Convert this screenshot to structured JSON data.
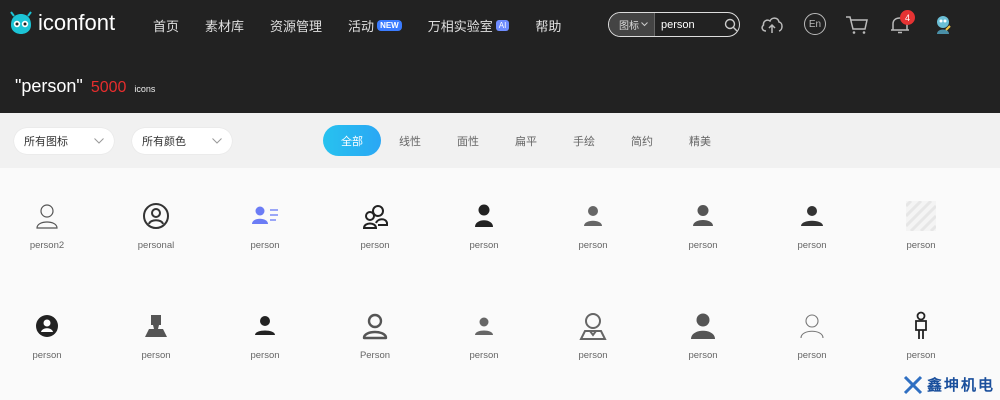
{
  "header": {
    "logo_text": "iconfont",
    "nav": [
      {
        "label": "首页"
      },
      {
        "label": "素材库"
      },
      {
        "label": "资源管理"
      },
      {
        "label": "活动",
        "badge": "NEW"
      },
      {
        "label": "万相实验室",
        "badge": "AI"
      },
      {
        "label": "帮助"
      }
    ],
    "search": {
      "type": "图标",
      "value": "person"
    },
    "lang": "En",
    "notification_count": "4"
  },
  "result": {
    "query": "\"person\"",
    "count": "5000",
    "unit": "icons"
  },
  "filters": {
    "icon_select": "所有图标",
    "color_select": "所有颜色",
    "tabs": [
      "全部",
      "线性",
      "面性",
      "扁平",
      "手绘",
      "简约",
      "精美"
    ],
    "active_tab": "全部"
  },
  "icons": [
    {
      "label": "person2",
      "icon": "person-outline-icon"
    },
    {
      "label": "personal",
      "icon": "person-circle-outline-icon"
    },
    {
      "label": "person",
      "icon": "person-card-icon"
    },
    {
      "label": "person",
      "icon": "people-outline-icon"
    },
    {
      "label": "person",
      "icon": "person-solid-icon"
    },
    {
      "label": "person",
      "icon": "person-gray-icon"
    },
    {
      "label": "person",
      "icon": "person-gray-icon"
    },
    {
      "label": "person",
      "icon": "person-gray-icon"
    },
    {
      "label": "person",
      "icon": "placeholder-icon"
    },
    {
      "label": "person",
      "icon": "person-circle-solid-icon"
    },
    {
      "label": "person",
      "icon": "person-bust-icon"
    },
    {
      "label": "person",
      "icon": "person-solid-icon"
    },
    {
      "label": "Person",
      "icon": "person-outline-bold-icon"
    },
    {
      "label": "person",
      "icon": "person-gray-icon"
    },
    {
      "label": "person",
      "icon": "person-outline-collar-icon"
    },
    {
      "label": "person",
      "icon": "person-large-icon"
    },
    {
      "label": "person",
      "icon": "person-thin-outline-icon"
    },
    {
      "label": "person",
      "icon": "person-standing-icon"
    }
  ],
  "watermark": {
    "text": "鑫坤机电"
  },
  "colors": {
    "header_bg": "#222222",
    "accent": "#27c2ef",
    "count_red": "#e62d2d",
    "badge_blue": "#3b7cff"
  }
}
